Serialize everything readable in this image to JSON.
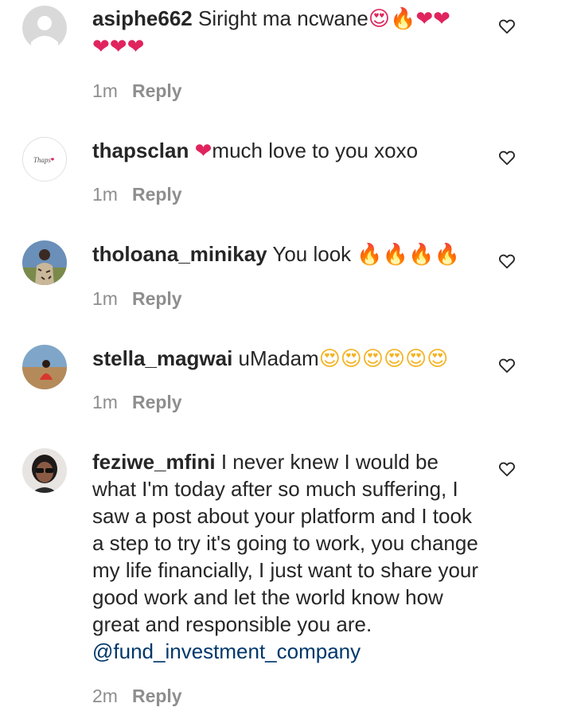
{
  "comments": [
    {
      "username": "asiphe662",
      "text_before": " Siright ma ncwane",
      "emoji_line1": "😍🔥❤❤",
      "emoji_line2": "❤❤❤",
      "time": "1m",
      "reply": "Reply",
      "avatar": "default-avatar"
    },
    {
      "username": "thapsclan",
      "emoji": "❤",
      "text": "much love to you xoxo",
      "time": "1m",
      "reply": "Reply",
      "avatar": "thapsclan-logo",
      "avatar_text": "Thaps"
    },
    {
      "username": "tholoana_minikay",
      "text": " You look ",
      "emoji": "🔥🔥🔥🔥",
      "time": "1m",
      "reply": "Reply",
      "avatar": "user-photo"
    },
    {
      "username": "stella_magwai",
      "text": " uMadam",
      "emoji": "😍😍😍😍😍😍",
      "time": "1m",
      "reply": "Reply",
      "avatar": "user-photo"
    },
    {
      "username": "feziwe_mfini",
      "text": " I never knew I would be what I'm today after so much suffering, I saw a post about your platform and I took a step to try it's going to work, you change my life financially, I just want to share your good work and let the world know how great and responsible you are. ",
      "mention": "@fund_investment_company",
      "time": "2m",
      "reply": "Reply",
      "avatar": "user-photo"
    }
  ],
  "icons": {
    "like": "heart-outline-icon"
  },
  "colors": {
    "text": "#262626",
    "meta": "#8e8e8e",
    "mention": "#00376b"
  }
}
